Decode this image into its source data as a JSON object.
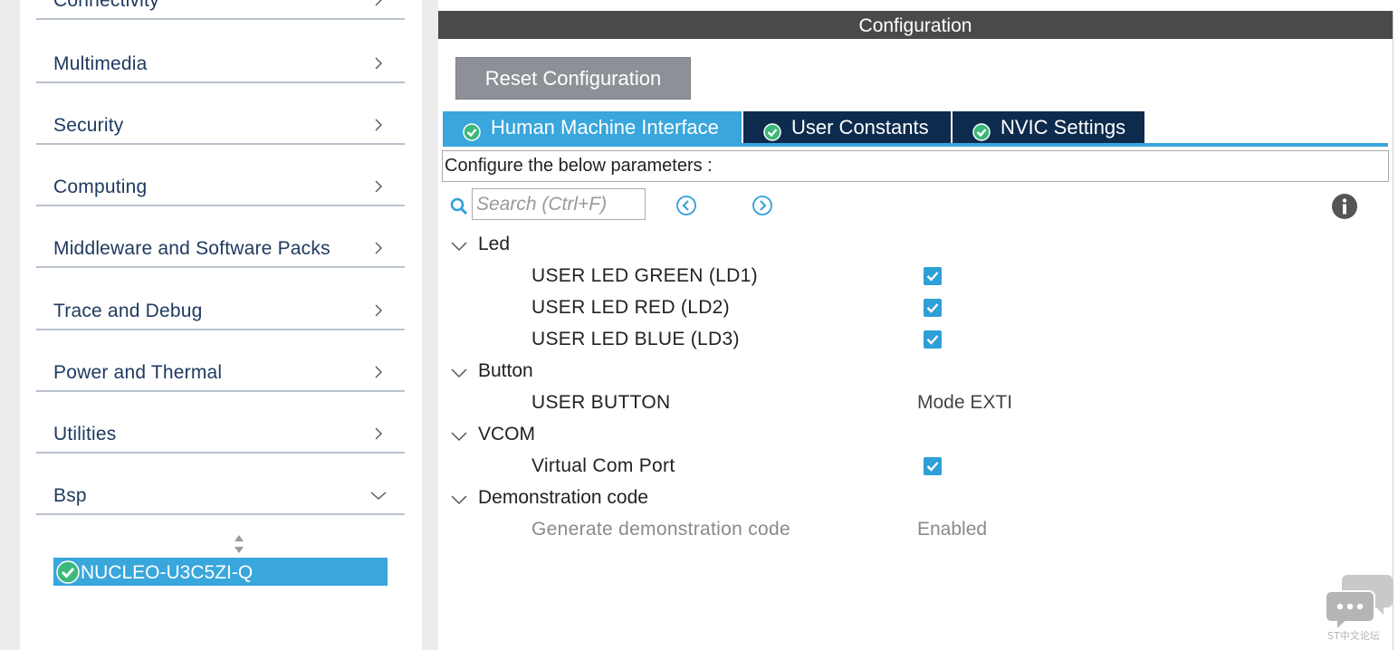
{
  "sidebar": {
    "categories": [
      {
        "label": "Connectivity",
        "expanded": false
      },
      {
        "label": "Multimedia",
        "expanded": false
      },
      {
        "label": "Security",
        "expanded": false
      },
      {
        "label": "Computing",
        "expanded": false
      },
      {
        "label": "Middleware and Software Packs",
        "expanded": false
      },
      {
        "label": "Trace and Debug",
        "expanded": false
      },
      {
        "label": "Power and Thermal",
        "expanded": false
      },
      {
        "label": "Utilities",
        "expanded": false
      },
      {
        "label": "Bsp",
        "expanded": true
      }
    ],
    "selected_board": "NUCLEO-U3C5ZI-Q"
  },
  "panel": {
    "title": "Configuration",
    "reset_button": "Reset Configuration",
    "tabs": [
      {
        "label": "Human Machine Interface",
        "active": true
      },
      {
        "label": "User Constants",
        "active": false
      },
      {
        "label": "NVIC Settings",
        "active": false
      }
    ],
    "params_caption": "Configure the below parameters :",
    "search_placeholder": "Search (Ctrl+F)"
  },
  "groups": [
    {
      "label": "Led",
      "items": [
        {
          "label": "USER LED GREEN (LD1)",
          "checked": true
        },
        {
          "label": "USER LED RED (LD2)",
          "checked": true
        },
        {
          "label": "USER LED BLUE (LD3)",
          "checked": true
        }
      ]
    },
    {
      "label": "Button",
      "items": [
        {
          "label": "USER BUTTON",
          "value": "Mode EXTI"
        }
      ]
    },
    {
      "label": "VCOM",
      "items": [
        {
          "label": "Virtual Com Port",
          "checked": true
        }
      ]
    },
    {
      "label": "Demonstration code",
      "items": [
        {
          "label": "Generate demonstration code",
          "value": "Enabled",
          "disabled": true
        }
      ]
    }
  ],
  "watermark": "ST中文论坛",
  "colors": {
    "accent": "#39a6dc",
    "tab_inactive": "#0d2b4d",
    "header": "#4a4a4a",
    "sidebar_text": "#1f3a60",
    "button": "#8d9197"
  },
  "icons": {
    "category_collapsed": "chevron-right-icon",
    "category_expanded": "chevron-down-icon",
    "tab_status": "check-circle-icon",
    "search": "search-icon",
    "prev": "previous-result-icon",
    "next": "next-result-icon",
    "info": "info-icon"
  }
}
